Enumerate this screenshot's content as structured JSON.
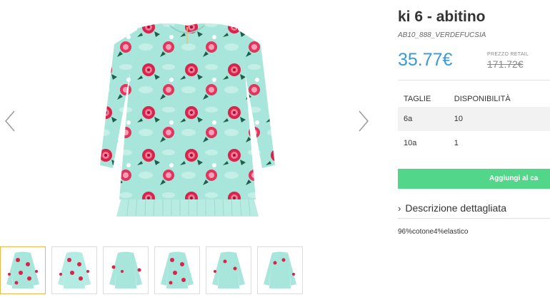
{
  "product": {
    "title": "ki 6 - abitino",
    "sku": "AB10_888_VERDEFUCSIA",
    "price": "35.77€",
    "retail_label": "PREZZO RETAIL",
    "retail_price": "171.72€"
  },
  "sizes": {
    "headers": [
      "TAGLIE",
      "DISPONIBILITÀ"
    ],
    "rows": [
      {
        "size": "6a",
        "availability": "10"
      },
      {
        "size": "10a",
        "availability": "1"
      }
    ]
  },
  "cart": {
    "button_label": "Aggiungi al ca"
  },
  "description": {
    "toggle_label": "Descrizione dettagliata",
    "text": "96%cotone4%elastico"
  },
  "gallery": {
    "thumbnail_count": 6,
    "active_thumbnail": 0
  },
  "colors": {
    "accent_price": "#3a9ad9",
    "cart_button": "#52d68a",
    "dress_base": "#a8e6dc",
    "flower_red": "#d8234a",
    "active_thumb_border": "#f0b64a"
  },
  "icons": {
    "prev": "chevron-left-icon",
    "next": "chevron-right-icon",
    "toggle": "chevron-right-icon"
  }
}
